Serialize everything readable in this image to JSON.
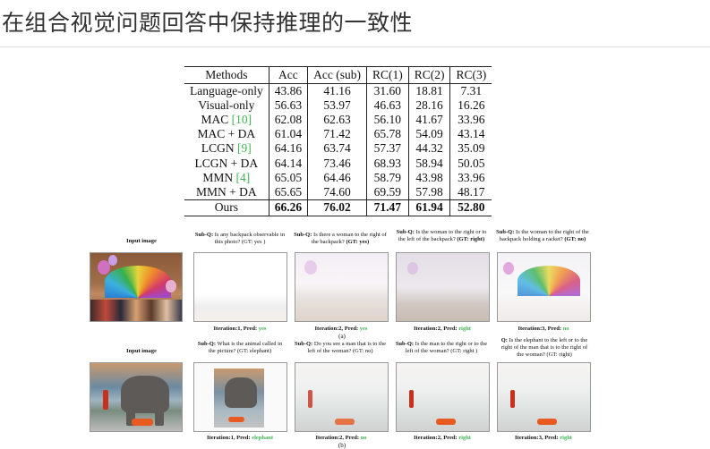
{
  "page": {
    "title": "在组合视觉问题回答中保持推理的一致性"
  },
  "table": {
    "headers": [
      "Methods",
      "Acc",
      "Acc (sub)",
      "RC(1)",
      "RC(2)",
      "RC(3)"
    ],
    "rows": [
      {
        "method": "Language-only",
        "cite": "",
        "values": [
          "43.86",
          "41.16",
          "31.60",
          "18.81",
          "7.31"
        ]
      },
      {
        "method": "Visual-only",
        "cite": "",
        "values": [
          "56.63",
          "53.97",
          "46.63",
          "28.16",
          "16.26"
        ]
      },
      {
        "method": "MAC ",
        "cite": "[10]",
        "values": [
          "62.08",
          "62.63",
          "56.10",
          "41.67",
          "33.96"
        ]
      },
      {
        "method": "MAC + DA",
        "cite": "",
        "values": [
          "61.04",
          "71.42",
          "65.78",
          "54.09",
          "43.14"
        ]
      },
      {
        "method": "LCGN ",
        "cite": "[9]",
        "values": [
          "64.16",
          "63.74",
          "57.37",
          "44.32",
          "35.09"
        ]
      },
      {
        "method": "LCGN + DA",
        "cite": "",
        "values": [
          "64.14",
          "73.46",
          "68.93",
          "58.94",
          "50.05"
        ]
      },
      {
        "method": "MMN ",
        "cite": "[4]",
        "values": [
          "65.05",
          "64.46",
          "58.79",
          "43.98",
          "33.96"
        ]
      },
      {
        "method": "MMN + DA",
        "cite": "",
        "values": [
          "65.65",
          "74.60",
          "69.59",
          "57.98",
          "48.17"
        ]
      }
    ],
    "ours": {
      "method": "Ours",
      "values": [
        "66.26",
        "76.02",
        "71.47",
        "61.94",
        "52.80"
      ]
    }
  },
  "figure": {
    "row_a": {
      "input_label": "Input image",
      "subqs": [
        {
          "prefix": "Sub-Q:",
          "text": " Is any backpack observable in this photo? ",
          "gt": "(GT: yes )"
        },
        {
          "prefix": "Sub-Q:",
          "text": " Is there a woman to the right of the backpack? ",
          "gt": "(GT: yes)"
        },
        {
          "prefix": "Sub-Q:",
          "text": " Is the woman to the right or to the left of the backpack? ",
          "gt": "(GT: right)"
        },
        {
          "prefix": "Sub-Q:",
          "text": " Is the woman to the right of the backpack holding a racket? ",
          "gt": "(GT: no)"
        }
      ],
      "captions": [
        {
          "text": "Iteration:1, Pred: ",
          "pred": "yes"
        },
        {
          "text": "Iteration:2, Pred: ",
          "pred": "yes"
        },
        {
          "text": "Iteration:2, Pred: ",
          "pred": "right"
        },
        {
          "text": "Iteration:3, Pred: ",
          "pred": "no"
        }
      ],
      "sublabel": "(a)"
    },
    "row_b": {
      "input_label": "Input image",
      "subqs": [
        {
          "prefix": "Sub-Q:",
          "text": " What is the animal called in the picture? ",
          "gt": "(GT: elephant)"
        },
        {
          "prefix": "Sub-Q:",
          "text": "  Do you see a man that is to the left of the woman? ",
          "gt": "(GT: no)"
        },
        {
          "prefix": "Sub-Q:",
          "text": " Is the man to the right or to the left of the woman? ",
          "gt": "(GT: right )"
        },
        {
          "prefix": "Q:",
          "text": " Is the elephant to the left or to the right of the man that is to the right of the woman? ",
          "gt": "(GT: right)"
        }
      ],
      "captions": [
        {
          "text": "Iteration:1, Pred: ",
          "pred": "elephant"
        },
        {
          "text": "Iteration:2, Pred: ",
          "pred": "no"
        },
        {
          "text": "Iteration:2, Pred: ",
          "pred": "right"
        },
        {
          "text": "Iteration:3, Pred: ",
          "pred": "right"
        }
      ],
      "sublabel": "(b)"
    }
  }
}
